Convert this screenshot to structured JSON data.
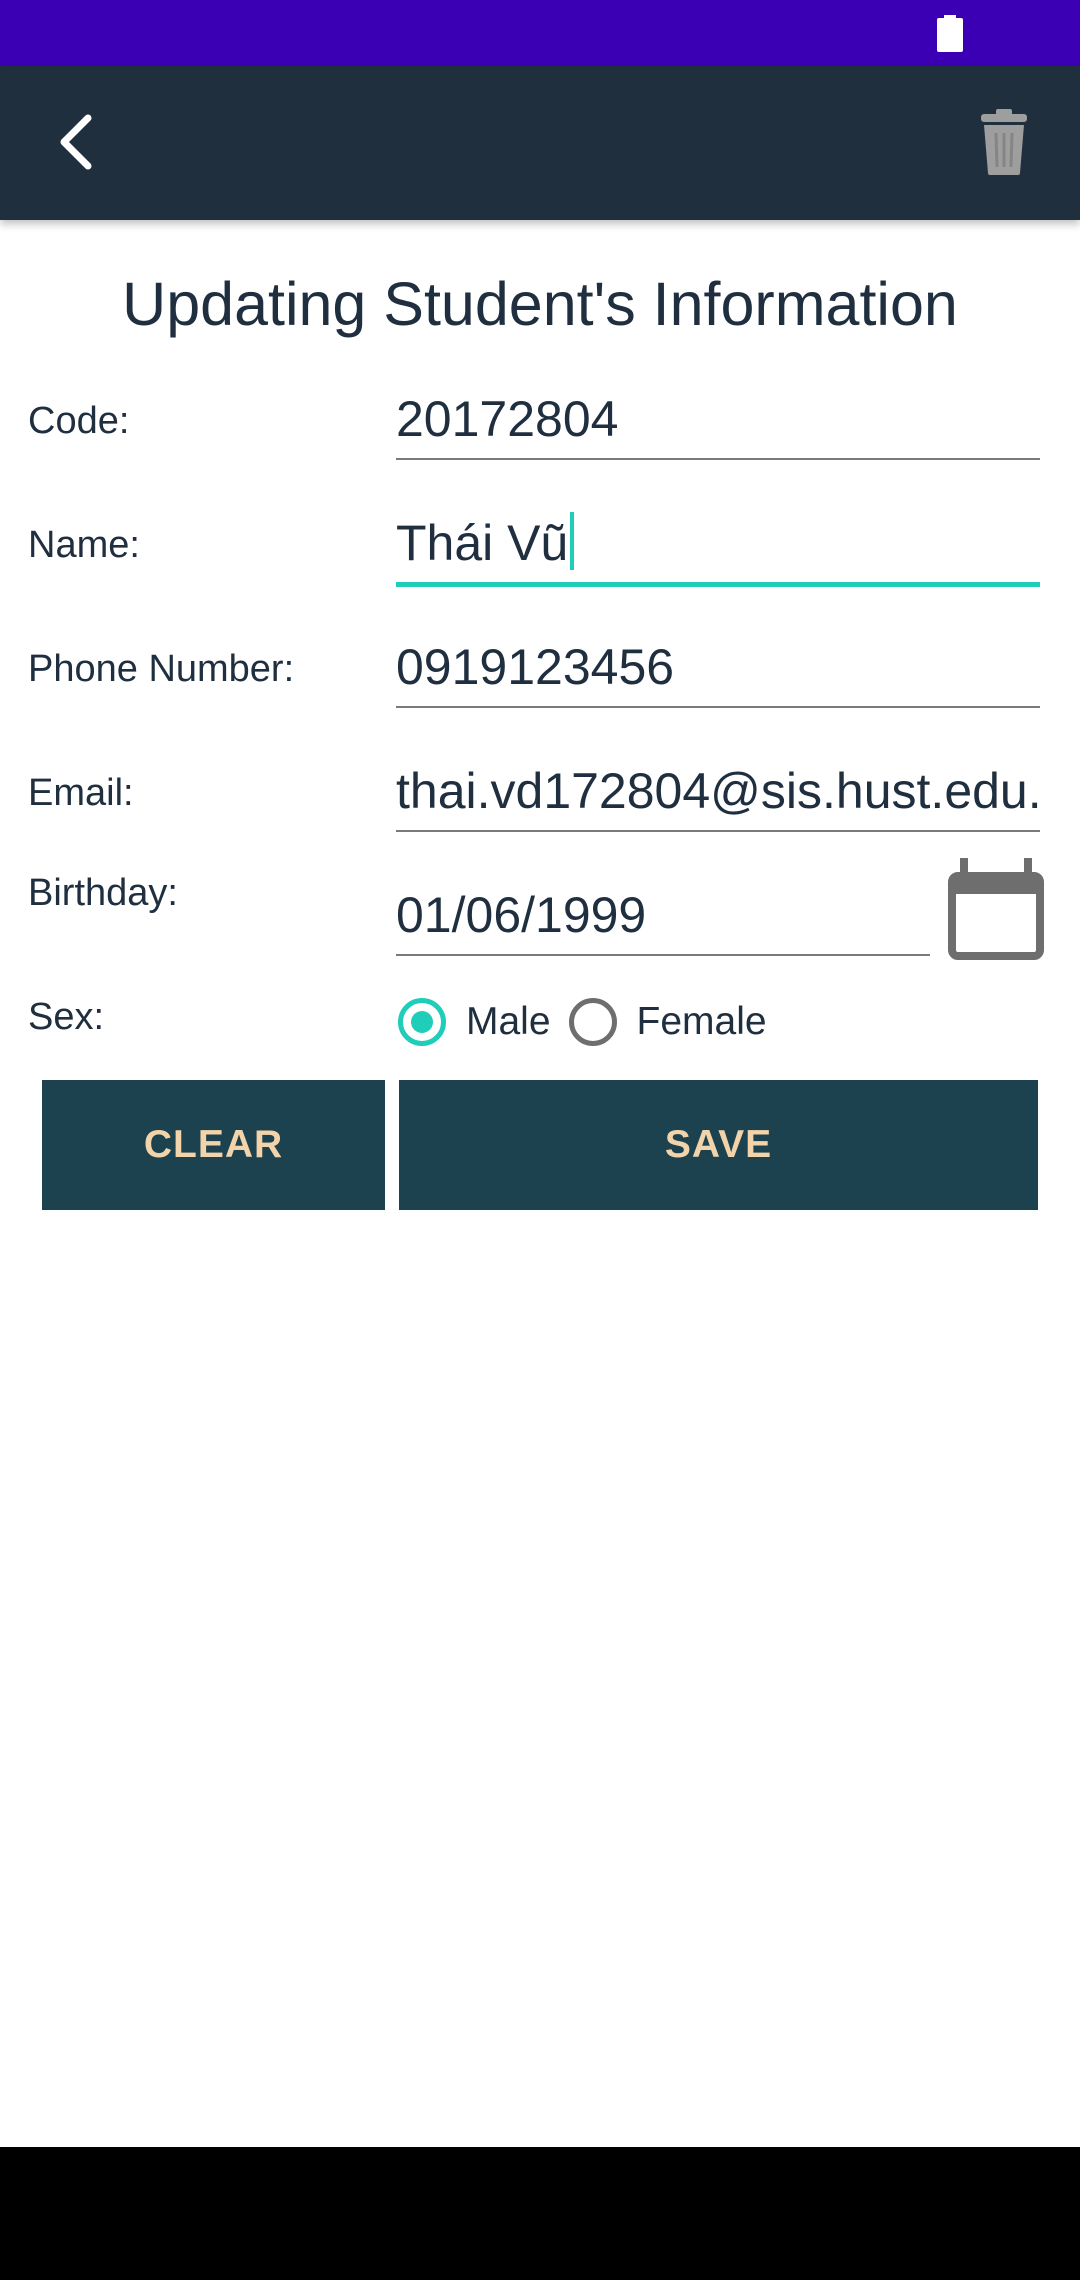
{
  "header": {
    "back_icon": "chevron-left-icon",
    "delete_icon": "trash-icon"
  },
  "page": {
    "title": "Updating Student's Information"
  },
  "form": {
    "code_label": "Code:",
    "code_value": "20172804",
    "name_label": "Name:",
    "name_value": "Thái Vũ",
    "phone_label": "Phone Number:",
    "phone_value": "0919123456",
    "email_label": "Email:",
    "email_value": "thai.vd172804@sis.hust.edu.",
    "birthday_label": "Birthday:",
    "birthday_value": "01/06/1999",
    "sex_label": "Sex:",
    "sex_options": [
      "Male",
      "Female"
    ],
    "sex_selected": "Male"
  },
  "actions": {
    "clear_label": "CLEAR",
    "save_label": "SAVE"
  },
  "colors": {
    "status_bar": "#3c00b4",
    "toolbar": "#202f3e",
    "accent": "#1fcdb8",
    "button_bg": "#1c424f",
    "button_text": "#f3d4aa"
  }
}
